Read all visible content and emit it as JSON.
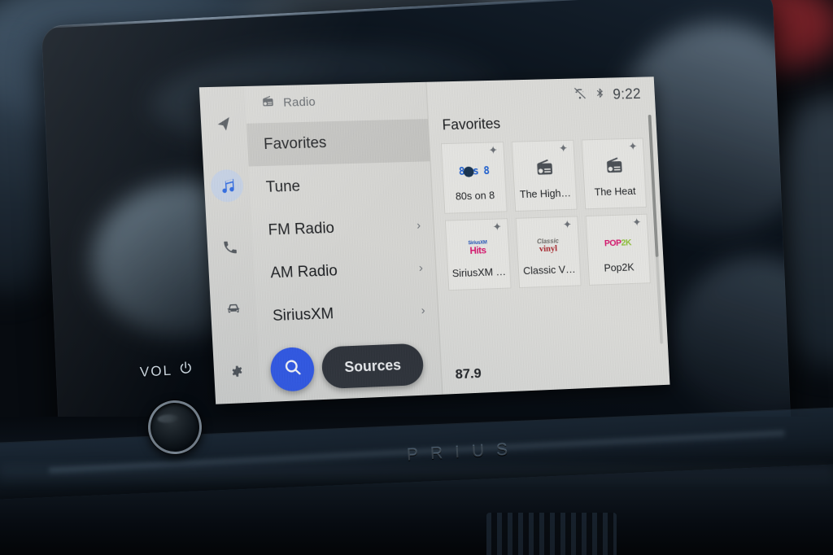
{
  "device": {
    "brand_badge": "PRIUS",
    "volume_label": "VOL",
    "power_icon": "power-icon",
    "knob": "volume-knob"
  },
  "screen": {
    "rail": {
      "items": [
        {
          "icon": "navigation-arrow-icon",
          "name": "navigation",
          "active": false
        },
        {
          "icon": "music-note-icon",
          "name": "media",
          "active": true
        },
        {
          "icon": "phone-icon",
          "name": "phone",
          "active": false
        },
        {
          "icon": "car-icon",
          "name": "vehicle",
          "active": false
        },
        {
          "icon": "gear-icon",
          "name": "settings",
          "active": false
        }
      ]
    },
    "menu": {
      "header": {
        "icon": "radio-icon",
        "title": "Radio"
      },
      "items": [
        {
          "label": "Favorites",
          "selected": true,
          "chevron": ""
        },
        {
          "label": "Tune",
          "selected": false,
          "chevron": ""
        },
        {
          "label": "FM Radio",
          "selected": false,
          "chevron": "›"
        },
        {
          "label": "AM Radio",
          "selected": false,
          "chevron": "›"
        },
        {
          "label": "SiriusXM",
          "selected": false,
          "chevron": "›"
        }
      ],
      "search_icon": "search-icon",
      "sources_label": "Sources"
    },
    "status_bar": {
      "no_connection_icon": "no-connection-icon",
      "bluetooth_icon": "bluetooth-icon",
      "clock": "9:22"
    },
    "content": {
      "title": "Favorites",
      "add_icon": "plus-icon",
      "tiles": [
        {
          "label": "80s on 8",
          "logo": "80s-on-8-logo",
          "logo_text": "80s on 8"
        },
        {
          "label": "The High…",
          "logo": "radio-icon",
          "logo_text": ""
        },
        {
          "label": "The Heat",
          "logo": "radio-icon",
          "logo_text": ""
        },
        {
          "label": "SiriusXM …",
          "logo": "siriusxm-hits-logo",
          "logo_text": "SiriusXM Hits"
        },
        {
          "label": "Classic V…",
          "logo": "classic-vinyl-logo",
          "logo_text": "Classic Vinyl"
        },
        {
          "label": "Pop2K",
          "logo": "pop2k-logo",
          "logo_text": "Pop2K"
        }
      ],
      "frequency": "87.9"
    },
    "colors": {
      "accent_blue": "#2d56ea",
      "active_icon_blue": "#1f5fe0",
      "panel_bg": "#dcdcd9",
      "menu_bg": "#d7d7d4",
      "selected_row": "#c4c4c1",
      "sources_btn": "#2b2f36"
    }
  }
}
